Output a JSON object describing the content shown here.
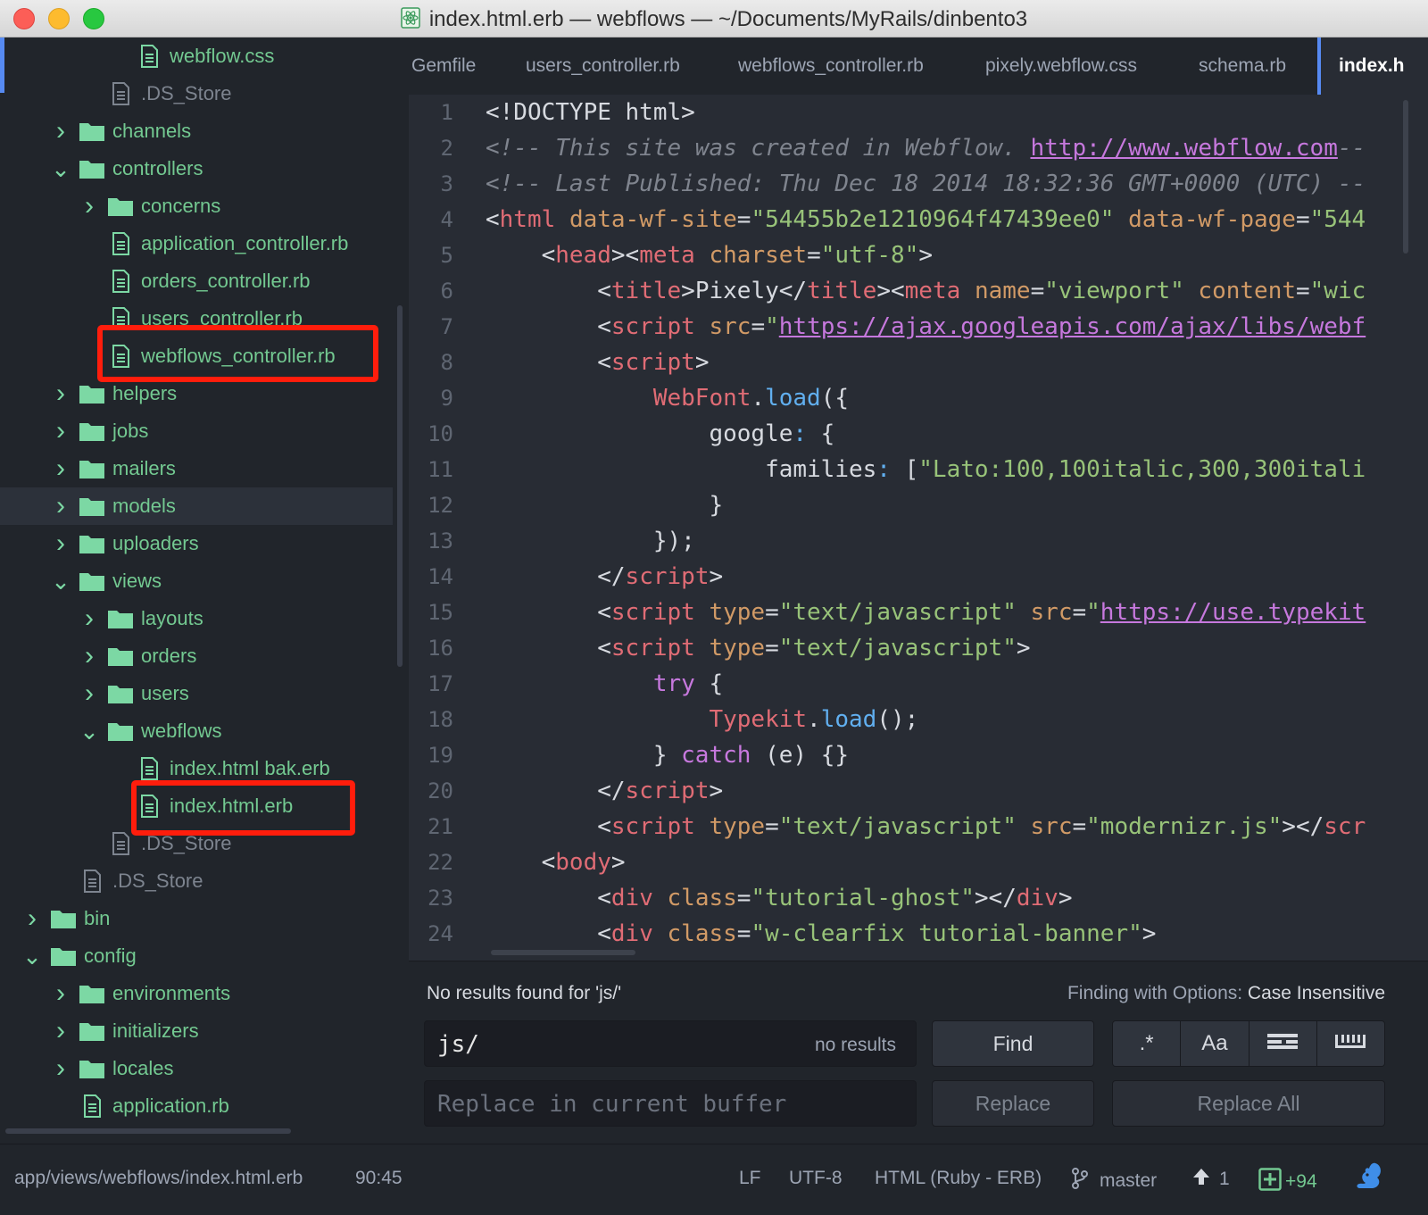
{
  "window": {
    "title": "index.html.erb — webflows — ~/Documents/MyRails/dinbento3",
    "title_icon": "atom-icon"
  },
  "sidebar": {
    "items": [
      {
        "label": "webflow.css",
        "type": "file",
        "depth": 4,
        "status": "git"
      },
      {
        "label": ".DS_Store",
        "type": "file",
        "depth": 3,
        "status": "ignored"
      },
      {
        "label": "channels",
        "type": "folder",
        "depth": 2,
        "expanded": false,
        "status": "git"
      },
      {
        "label": "controllers",
        "type": "folder",
        "depth": 2,
        "expanded": true,
        "status": "git"
      },
      {
        "label": "concerns",
        "type": "folder",
        "depth": 3,
        "expanded": false,
        "status": "git"
      },
      {
        "label": "application_controller.rb",
        "type": "file",
        "depth": 3,
        "status": "git"
      },
      {
        "label": "orders_controller.rb",
        "type": "file",
        "depth": 3,
        "status": "git"
      },
      {
        "label": "users_controller.rb",
        "type": "file",
        "depth": 3,
        "status": "git"
      },
      {
        "label": "webflows_controller.rb",
        "type": "file",
        "depth": 3,
        "status": "git",
        "highlighted": true
      },
      {
        "label": "helpers",
        "type": "folder",
        "depth": 2,
        "expanded": false,
        "status": "git"
      },
      {
        "label": "jobs",
        "type": "folder",
        "depth": 2,
        "expanded": false,
        "status": "git"
      },
      {
        "label": "mailers",
        "type": "folder",
        "depth": 2,
        "expanded": false,
        "status": "git"
      },
      {
        "label": "models",
        "type": "folder",
        "depth": 2,
        "expanded": false,
        "status": "git",
        "selected": true
      },
      {
        "label": "uploaders",
        "type": "folder",
        "depth": 2,
        "expanded": false,
        "status": "git"
      },
      {
        "label": "views",
        "type": "folder",
        "depth": 2,
        "expanded": true,
        "status": "git"
      },
      {
        "label": "layouts",
        "type": "folder",
        "depth": 3,
        "expanded": false,
        "status": "git"
      },
      {
        "label": "orders",
        "type": "folder",
        "depth": 3,
        "expanded": false,
        "status": "git"
      },
      {
        "label": "users",
        "type": "folder",
        "depth": 3,
        "expanded": false,
        "status": "git"
      },
      {
        "label": "webflows",
        "type": "folder",
        "depth": 3,
        "expanded": true,
        "status": "git"
      },
      {
        "label": "index.html bak.erb",
        "type": "file",
        "depth": 4,
        "status": "git"
      },
      {
        "label": "index.html.erb",
        "type": "file",
        "depth": 4,
        "status": "git",
        "highlighted": true
      },
      {
        "label": ".DS_Store",
        "type": "file",
        "depth": 3,
        "status": "ignored"
      },
      {
        "label": ".DS_Store",
        "type": "file",
        "depth": 2,
        "status": "ignored"
      },
      {
        "label": "bin",
        "type": "folder",
        "depth": 1,
        "expanded": false,
        "status": "git"
      },
      {
        "label": "config",
        "type": "folder",
        "depth": 1,
        "expanded": true,
        "status": "git"
      },
      {
        "label": "environments",
        "type": "folder",
        "depth": 2,
        "expanded": false,
        "status": "git"
      },
      {
        "label": "initializers",
        "type": "folder",
        "depth": 2,
        "expanded": false,
        "status": "git"
      },
      {
        "label": "locales",
        "type": "folder",
        "depth": 2,
        "expanded": false,
        "status": "git"
      },
      {
        "label": "application.rb",
        "type": "file",
        "depth": 2,
        "status": "git"
      }
    ]
  },
  "tabs": [
    {
      "label": "Gemfile",
      "active": false
    },
    {
      "label": "users_controller.rb",
      "active": false
    },
    {
      "label": "webflows_controller.rb",
      "active": false
    },
    {
      "label": "pixely.webflow.css",
      "active": false
    },
    {
      "label": "schema.rb",
      "active": false
    },
    {
      "label": "index.h",
      "active": true
    }
  ],
  "editor": {
    "lines": [
      {
        "n": "1",
        "tokens": [
          [
            "pun",
            "<!DOCTYPE html>"
          ]
        ]
      },
      {
        "n": "2",
        "tokens": [
          [
            "com",
            "<!-- This site was created in Webflow. "
          ],
          [
            "link",
            "http://www.webflow.com"
          ],
          [
            "com",
            "--"
          ]
        ]
      },
      {
        "n": "3",
        "tokens": [
          [
            "com",
            "<!-- Last Published: Thu Dec 18 2014 18:32:36 GMT+0000 (UTC) --"
          ]
        ]
      },
      {
        "n": "4",
        "tokens": [
          [
            "pun",
            "<"
          ],
          [
            "tag",
            "html"
          ],
          [
            "pun",
            " "
          ],
          [
            "attr",
            "data-wf-site"
          ],
          [
            "pun",
            "="
          ],
          [
            "str",
            "\"54455b2e1210964f47439ee0\""
          ],
          [
            "pun",
            " "
          ],
          [
            "attr",
            "data-wf-page"
          ],
          [
            "pun",
            "="
          ],
          [
            "str",
            "\"544"
          ]
        ]
      },
      {
        "n": "5",
        "tokens": [
          [
            "pun",
            "    <"
          ],
          [
            "tag",
            "head"
          ],
          [
            "pun",
            "><"
          ],
          [
            "tag",
            "meta"
          ],
          [
            "pun",
            " "
          ],
          [
            "attr",
            "charset"
          ],
          [
            "pun",
            "="
          ],
          [
            "str",
            "\"utf-8\""
          ],
          [
            "pun",
            ">"
          ]
        ]
      },
      {
        "n": "6",
        "tokens": [
          [
            "pun",
            "        <"
          ],
          [
            "tag",
            "title"
          ],
          [
            "pun",
            ">Pixely</"
          ],
          [
            "tag",
            "title"
          ],
          [
            "pun",
            "><"
          ],
          [
            "tag",
            "meta"
          ],
          [
            "pun",
            " "
          ],
          [
            "attr",
            "name"
          ],
          [
            "pun",
            "="
          ],
          [
            "str",
            "\"viewport\""
          ],
          [
            "pun",
            " "
          ],
          [
            "attr",
            "content"
          ],
          [
            "pun",
            "="
          ],
          [
            "str",
            "\"wic"
          ]
        ]
      },
      {
        "n": "7",
        "tokens": [
          [
            "pun",
            "        <"
          ],
          [
            "tag",
            "script"
          ],
          [
            "pun",
            " "
          ],
          [
            "attr",
            "src"
          ],
          [
            "pun",
            "="
          ],
          [
            "str",
            "\""
          ],
          [
            "link",
            "https://ajax.googleapis.com/ajax/libs/webf"
          ]
        ]
      },
      {
        "n": "8",
        "tokens": [
          [
            "pun",
            "        <"
          ],
          [
            "tag",
            "script"
          ],
          [
            "pun",
            ">"
          ]
        ]
      },
      {
        "n": "9",
        "tokens": [
          [
            "pun",
            "            "
          ],
          [
            "tag",
            "WebFont"
          ],
          [
            "pun",
            "."
          ],
          [
            "fn",
            "load"
          ],
          [
            "pun",
            "({"
          ]
        ]
      },
      {
        "n": "10",
        "tokens": [
          [
            "pun",
            "                google"
          ],
          [
            "fn",
            ":"
          ],
          [
            "pun",
            " {"
          ]
        ]
      },
      {
        "n": "11",
        "tokens": [
          [
            "pun",
            "                    families"
          ],
          [
            "fn",
            ":"
          ],
          [
            "pun",
            " ["
          ],
          [
            "str",
            "\"Lato:100,100italic,300,300itali"
          ]
        ]
      },
      {
        "n": "12",
        "tokens": [
          [
            "pun",
            "                }"
          ]
        ]
      },
      {
        "n": "13",
        "tokens": [
          [
            "pun",
            "            });"
          ]
        ]
      },
      {
        "n": "14",
        "tokens": [
          [
            "pun",
            "        </"
          ],
          [
            "tag",
            "script"
          ],
          [
            "pun",
            ">"
          ]
        ]
      },
      {
        "n": "15",
        "tokens": [
          [
            "pun",
            "        <"
          ],
          [
            "tag",
            "script"
          ],
          [
            "pun",
            " "
          ],
          [
            "attr",
            "type"
          ],
          [
            "pun",
            "="
          ],
          [
            "str",
            "\"text/javascript\""
          ],
          [
            "pun",
            " "
          ],
          [
            "attr",
            "src"
          ],
          [
            "pun",
            "="
          ],
          [
            "str",
            "\""
          ],
          [
            "link",
            "https://use.typekit"
          ]
        ]
      },
      {
        "n": "16",
        "tokens": [
          [
            "pun",
            "        <"
          ],
          [
            "tag",
            "script"
          ],
          [
            "pun",
            " "
          ],
          [
            "attr",
            "type"
          ],
          [
            "pun",
            "="
          ],
          [
            "str",
            "\"text/javascript\""
          ],
          [
            "pun",
            ">"
          ]
        ]
      },
      {
        "n": "17",
        "tokens": [
          [
            "pun",
            "            "
          ],
          [
            "kw",
            "try"
          ],
          [
            "pun",
            " {"
          ]
        ]
      },
      {
        "n": "18",
        "tokens": [
          [
            "pun",
            "                "
          ],
          [
            "tag",
            "Typekit"
          ],
          [
            "pun",
            "."
          ],
          [
            "fn",
            "load"
          ],
          [
            "pun",
            "();"
          ]
        ]
      },
      {
        "n": "19",
        "tokens": [
          [
            "pun",
            "            } "
          ],
          [
            "kw",
            "catch"
          ],
          [
            "pun",
            " (e) {}"
          ]
        ]
      },
      {
        "n": "20",
        "tokens": [
          [
            "pun",
            "        </"
          ],
          [
            "tag",
            "script"
          ],
          [
            "pun",
            ">"
          ]
        ]
      },
      {
        "n": "21",
        "tokens": [
          [
            "pun",
            "        <"
          ],
          [
            "tag",
            "script"
          ],
          [
            "pun",
            " "
          ],
          [
            "attr",
            "type"
          ],
          [
            "pun",
            "="
          ],
          [
            "str",
            "\"text/javascript\""
          ],
          [
            "pun",
            " "
          ],
          [
            "attr",
            "src"
          ],
          [
            "pun",
            "="
          ],
          [
            "str",
            "\"modernizr.js\""
          ],
          [
            "pun",
            "></"
          ],
          [
            "tag",
            "scr"
          ]
        ]
      },
      {
        "n": "22",
        "tokens": [
          [
            "pun",
            "    <"
          ],
          [
            "tag",
            "body"
          ],
          [
            "pun",
            ">"
          ]
        ]
      },
      {
        "n": "23",
        "tokens": [
          [
            "pun",
            "        <"
          ],
          [
            "tag",
            "div"
          ],
          [
            "pun",
            " "
          ],
          [
            "attr",
            "class"
          ],
          [
            "pun",
            "="
          ],
          [
            "str",
            "\"tutorial-ghost\""
          ],
          [
            "pun",
            "></"
          ],
          [
            "tag",
            "div"
          ],
          [
            "pun",
            ">"
          ]
        ]
      },
      {
        "n": "24",
        "tokens": [
          [
            "pun",
            "        <"
          ],
          [
            "tag",
            "div"
          ],
          [
            "pun",
            " "
          ],
          [
            "attr",
            "class"
          ],
          [
            "pun",
            "="
          ],
          [
            "str",
            "\"w-clearfix tutorial-banner\""
          ],
          [
            "pun",
            ">"
          ]
        ]
      }
    ]
  },
  "find": {
    "message": "No results found for 'js/'",
    "options_label": "Finding with Options: ",
    "options_value": "Case Insensitive",
    "find_value": "js/",
    "find_count": "no results",
    "replace_placeholder": "Replace in current buffer",
    "find_button": "Find",
    "replace_button": "Replace",
    "replace_all_button": "Replace All",
    "option_regex": ".*",
    "option_case": "Aa",
    "option_selection_icon": "in-selection-icon",
    "option_wholeword_icon": "whole-word-icon"
  },
  "status": {
    "path": "app/views/webflows/index.html.erb",
    "cursor": "90:45",
    "line_ending": "LF",
    "encoding": "UTF-8",
    "grammar": "HTML (Ruby - ERB)",
    "branch": "master",
    "ahead": "1",
    "diff": "+94",
    "branch_icon": "git-branch-icon",
    "ahead_icon": "arrow-up-icon",
    "diff_icon": "diff-added-icon",
    "squirrel_icon": "squirrel-icon"
  },
  "colors": {
    "accent": "#568af2",
    "git_added": "#73c991",
    "highlight_box": "#ff1d0c"
  }
}
